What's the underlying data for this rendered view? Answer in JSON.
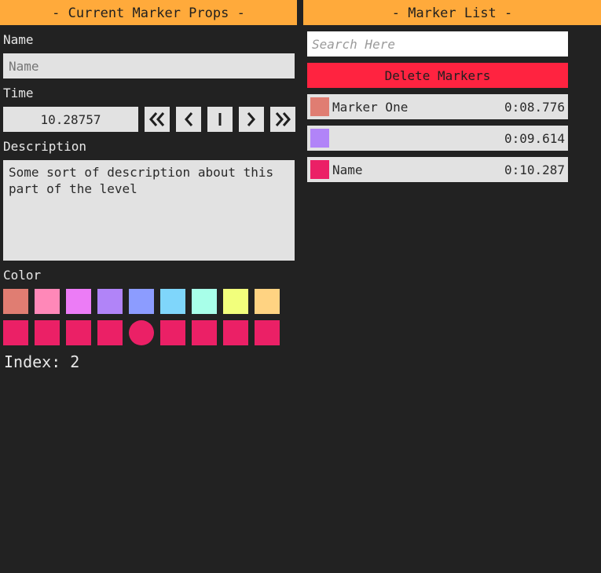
{
  "props_panel": {
    "header": "- Current Marker Props -",
    "name_label": "Name",
    "name_placeholder": "Name",
    "time_label": "Time",
    "time_value": "10.28757",
    "description_label": "Description",
    "description_value": "Some sort of description about this part of the level",
    "color_label": "Color",
    "palette_row1": [
      "#e07d72",
      "#ff88b8",
      "#ec7cf6",
      "#b184f8",
      "#8c9cff",
      "#7fd6fb",
      "#a8ffe9",
      "#f2ff7c",
      "#ffd382"
    ],
    "palette_row2": [
      "#eb2066",
      "#eb2066",
      "#eb2066",
      "#eb2066",
      "#eb2066",
      "#eb2066",
      "#eb2066",
      "#eb2066",
      "#eb2066"
    ],
    "selected_row2_index": 4,
    "index_text": "Index: 2"
  },
  "list_panel": {
    "header": "- Marker List -",
    "search_placeholder": "Search Here",
    "delete_label": "Delete Markers",
    "markers": [
      {
        "name": "Marker One",
        "time": "0:08.776",
        "color": "#e07d72"
      },
      {
        "name": "",
        "time": "0:09.614",
        "color": "#b184f8"
      },
      {
        "name": "Name",
        "time": "0:10.287",
        "color": "#eb2066"
      }
    ]
  },
  "icons": {
    "time_buttons": [
      "double-chevron-left-icon",
      "chevron-left-icon",
      "bar-icon",
      "chevron-right-icon",
      "double-chevron-right-icon"
    ]
  }
}
